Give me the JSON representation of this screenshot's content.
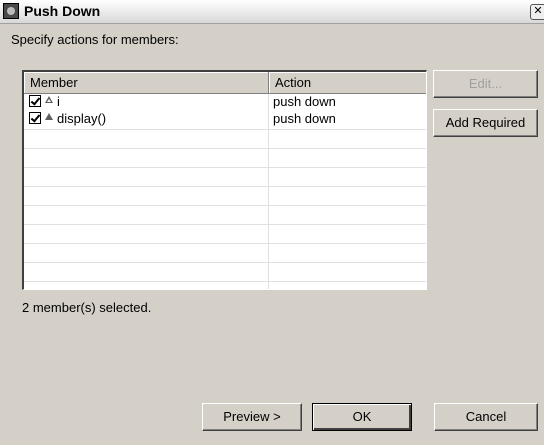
{
  "window": {
    "title": "Push Down",
    "close_icon": "close-icon"
  },
  "instruction": "Specify actions for members:",
  "table": {
    "columns": [
      "Member",
      "Action"
    ],
    "rows": [
      {
        "checked": true,
        "icon": "field-icon",
        "member": "i",
        "action": "push down"
      },
      {
        "checked": true,
        "icon": "method-icon",
        "member": "display()",
        "action": "push down"
      }
    ]
  },
  "buttons": {
    "edit": "Edit...",
    "add_required": "Add Required",
    "preview": "Preview >",
    "ok": "OK",
    "cancel": "Cancel"
  },
  "status": "2 member(s) selected."
}
